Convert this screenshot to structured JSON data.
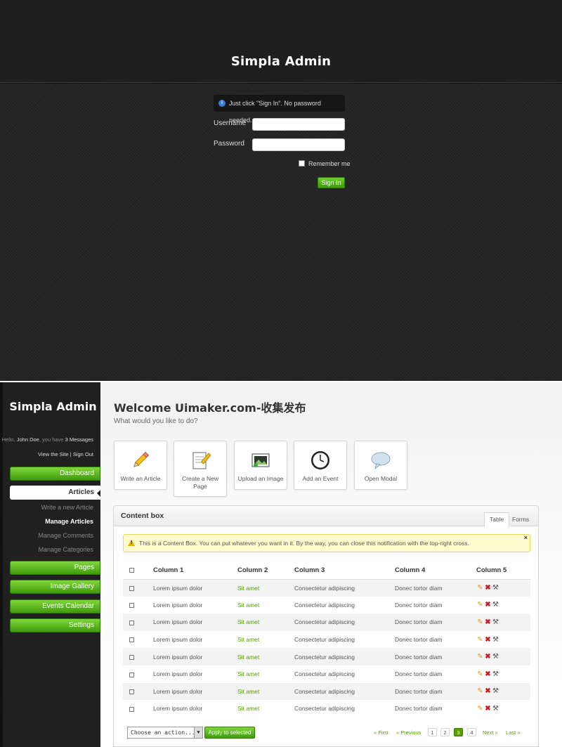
{
  "login": {
    "title": "Simpla Admin",
    "notice": "Just click \"Sign In\". No password needed.",
    "username_label": "Username",
    "password_label": "Password",
    "remember_label": "Remember me",
    "signin_label": "Sign In"
  },
  "sidebar": {
    "logo": "Simpla Admin",
    "greeting": {
      "prefix": "Hello, ",
      "name": "John Doe",
      "middle": ", you have ",
      "messages": "3 Messages"
    },
    "links": {
      "view_site": "View the Site",
      "separator": " | ",
      "sign_out": "Sign Out"
    },
    "nav": [
      {
        "label": "Dashboard",
        "active": false
      },
      {
        "label": "Articles",
        "active": true
      },
      {
        "label": "Pages",
        "active": false
      },
      {
        "label": "Image Gallery",
        "active": false
      },
      {
        "label": "Events Calendar",
        "active": false
      },
      {
        "label": "Settings",
        "active": false
      }
    ],
    "subnav": [
      {
        "label": "Write a new Article",
        "current": false
      },
      {
        "label": "Manage Articles",
        "current": true
      },
      {
        "label": "Manage Comments",
        "current": false
      },
      {
        "label": "Manage Categories",
        "current": false
      }
    ]
  },
  "main": {
    "title": "Welcome Uimaker.com-收集发布",
    "subtitle": "What would you like to do?",
    "shortcuts": [
      {
        "label": "Write an Article",
        "icon": "pencil-icon"
      },
      {
        "label": "Create a New Page",
        "icon": "notepad-icon"
      },
      {
        "label": "Upload an Image",
        "icon": "image-icon"
      },
      {
        "label": "Add an Event",
        "icon": "clock-icon"
      },
      {
        "label": "Open Modal",
        "icon": "speech-bubble-icon"
      }
    ],
    "content_box": {
      "title": "Content box",
      "tabs": [
        {
          "label": "Table",
          "current": true
        },
        {
          "label": "Forms",
          "current": false
        }
      ],
      "notice": "This is a Content Box. You can put whatever you want in it. By the way, you can close this notification with the top-right cross.",
      "notice_close": "×",
      "columns": [
        "Column 1",
        "Column 2",
        "Column 3",
        "Column 4",
        "Column 5"
      ],
      "rows": [
        [
          "Lorem ipsum dolor",
          "Sit amet",
          "Consectetur adipiscing",
          "Donec tortor diam"
        ],
        [
          "Lorem ipsum dolor",
          "Sit amet",
          "Consectetur adipiscing",
          "Donec tortor diam"
        ],
        [
          "Lorem ipsum dolor",
          "Sit amet",
          "Consectetur adipiscing",
          "Donec tortor diam"
        ],
        [
          "Lorem ipsum dolor",
          "Sit amet",
          "Consectetur adipiscing",
          "Donec tortor diam"
        ],
        [
          "Lorem ipsum dolor",
          "Sit amet",
          "Consectetur adipiscing",
          "Donec tortor diam"
        ],
        [
          "Lorem ipsum dolor",
          "Sit amet",
          "Consectetur adipiscing",
          "Donec tortor diam"
        ],
        [
          "Lorem ipsum dolor",
          "Sit amet",
          "Consectetur adipiscing",
          "Donec tortor diam"
        ],
        [
          "Lorem ipsum dolor",
          "Sit amet",
          "Consectetur adipiscing",
          "Donec tortor diam"
        ]
      ],
      "row_actions": [
        "edit-icon",
        "delete-icon",
        "settings-icon"
      ],
      "bulk_select": "Choose an action...",
      "apply_label": "Apply to selected",
      "pagination": {
        "first": "« First",
        "previous": "« Previous",
        "pages": [
          "1",
          "2",
          "3",
          "4"
        ],
        "current_page": "3",
        "next": "Next »",
        "last": "Last »"
      }
    }
  },
  "colors": {
    "accent_green": "#57a000",
    "button_green": "#4fb31a",
    "dark_bg": "#262626",
    "notice_yellow": "#fffbcc"
  }
}
